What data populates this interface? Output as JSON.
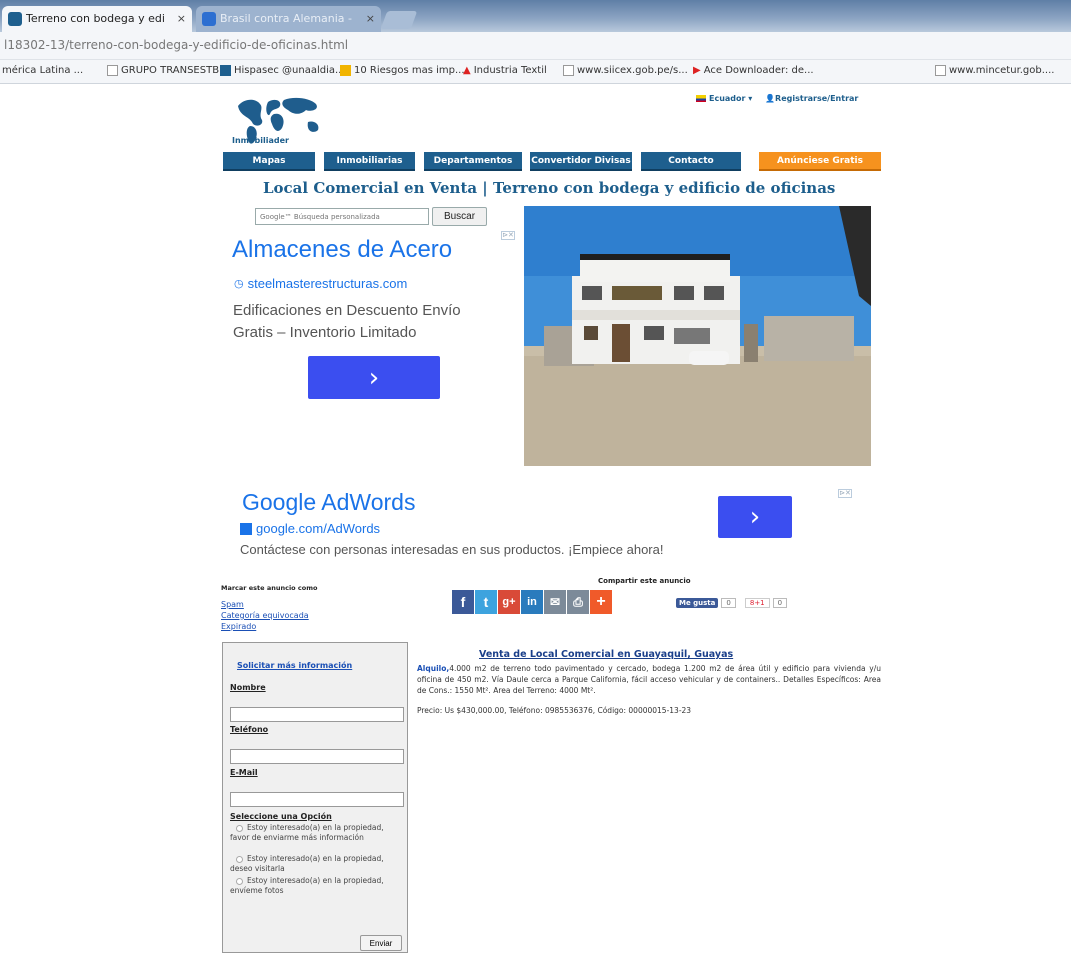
{
  "browser": {
    "tabs": [
      {
        "label": "Terreno con bodega y edi",
        "active": true
      },
      {
        "label": "Brasil contra Alemania - ",
        "active": false
      }
    ],
    "url": "l18302-13/terreno-con-bodega-y-edificio-de-oficinas.html",
    "bookmarks": [
      "mérica Latina ...",
      "GRUPO TRANSESTB...",
      "Hispasec @unaaldia...",
      "10 Riesgos mas imp...",
      "Industria Textil",
      "www.siicex.gob.pe/s...",
      "Ace Downloader: de...",
      "www.mincetur.gob...."
    ]
  },
  "header": {
    "logo_text": "Inmobiliader",
    "country": "Ecuador",
    "login": "Registrarse/Entrar"
  },
  "nav": [
    "Mapas",
    "Inmobiliarias",
    "Departamentos",
    "Convertidor Divisas",
    "Contacto",
    "Anúnciese Gratis"
  ],
  "page_title": "Local Comercial en Venta | Terreno con bodega y edificio de oficinas",
  "search": {
    "placeholder": "Google™ Búsqueda personalizada",
    "button": "Buscar"
  },
  "ad1": {
    "title": "Almacenes de Acero",
    "url": "steelmasterestructuras.com",
    "desc": "Edificaciones en Descuento Envío Gratis – Inventorio Limitado",
    "arrow": "›"
  },
  "ad2": {
    "title": "Google AdWords",
    "url": "google.com/AdWords",
    "desc": "Contáctese con personas interesadas en sus productos. ¡Empiece ahora!",
    "arrow": "›"
  },
  "mark": {
    "title": "Marcar este anuncio como",
    "links": [
      "Spam",
      "Categoría equivocada",
      "Expirado"
    ]
  },
  "share": {
    "title": "Compartir este anuncio",
    "like_label": "Me gusta",
    "like_count": "0",
    "gplus_label": "8+1",
    "gplus_count": "0"
  },
  "form": {
    "title": "Solicitar más información",
    "name_label": "Nombre",
    "phone_label": "Teléfono",
    "email_label": "E-Mail",
    "options_label": "Seleccione una Opción",
    "options": [
      "Estoy interesado(a) en la propiedad, favor de enviarme más información",
      "Estoy interesado(a) en la propiedad, deseo visitarla",
      "Estoy interesado(a) en la propiedad, envíeme fotos"
    ],
    "submit": "Enviar"
  },
  "listing": {
    "title": "Venta de Local Comercial en Guayaquil, Guayas",
    "brand": "Alquilo,",
    "description": "4.000 m2 de terreno todo pavimentado y cercado, bodega 1.200 m2 de área útil y edificio para vivienda y/u oficina de 450 m2. Vía Daule cerca a Parque California, fácil acceso vehicular y de containers.. Detalles Específicos: Area de Cons.: 1550 Mt². Area del Terreno: 4000 Mt².",
    "price_line": "Precio: Us $430,000.00, Teléfono: 0985536376, Código: 00000015-13-23"
  },
  "colors": {
    "nav_blue": "#1e5f8e",
    "nav_orange": "#f6921e",
    "ad_blue": "#1a73e8",
    "ad_button": "#3b4ef0"
  }
}
